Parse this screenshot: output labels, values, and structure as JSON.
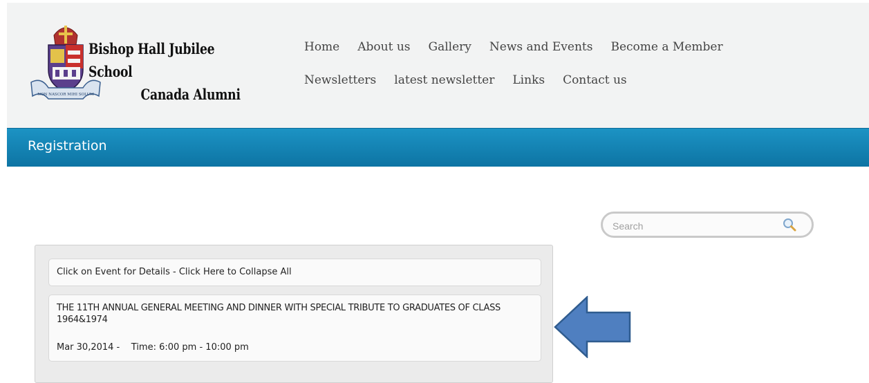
{
  "site": {
    "title_line1": "Bishop Hall Jubilee School",
    "title_line2": "Canada Alumni",
    "crest_motto": "NON NASCOR MIHI SOLUM"
  },
  "nav": {
    "row1": [
      "Home",
      "About us",
      "Gallery",
      "News and Events",
      "Become a Member"
    ],
    "row2": [
      "Newsletters",
      "latest newsletter",
      "Links",
      "Contact us"
    ]
  },
  "page": {
    "title": "Registration"
  },
  "search": {
    "placeholder": "Search",
    "icon": "magnifier-icon"
  },
  "events": {
    "collapse_label": "Click on Event for Details - Click Here to Collapse All",
    "items": [
      {
        "title": "THE 11TH ANNUAL GENERAL MEETING AND DINNER WITH SPECIAL TRIBUTE TO GRADUATES OF CLASS 1964&1974",
        "date": "Mar 30,2014 -",
        "time": "Time: 6:00 pm - 10:00 pm"
      }
    ]
  },
  "colors": {
    "banner": "#1485b8",
    "header_bg": "#f2f3f3",
    "arrow_fill": "#4f7fc0",
    "arrow_stroke": "#2f5c8f"
  }
}
